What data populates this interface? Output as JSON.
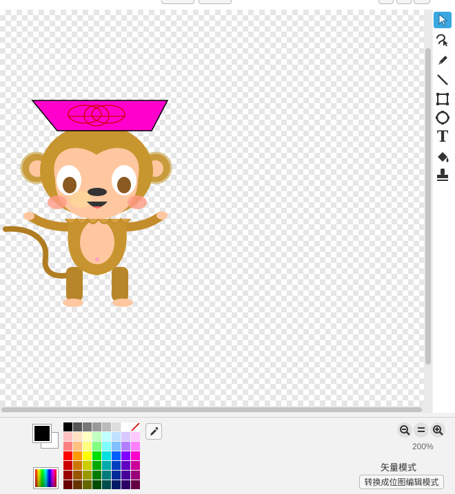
{
  "top_bar": {
    "button_1_label": "",
    "button_2_label": ""
  },
  "tools": [
    {
      "name": "select-tool",
      "icon": "arrow-cursor-icon",
      "active": true
    },
    {
      "name": "reshape-tool",
      "icon": "reshape-icon"
    },
    {
      "name": "pencil-tool",
      "icon": "pencil-icon"
    },
    {
      "name": "line-tool",
      "icon": "line-icon"
    },
    {
      "name": "rectangle-tool",
      "icon": "rectangle-icon"
    },
    {
      "name": "ellipse-tool",
      "icon": "ellipse-icon"
    },
    {
      "name": "text-tool",
      "icon": "text-T-icon",
      "glyph": "T"
    },
    {
      "name": "fill-tool",
      "icon": "paint-bucket-icon"
    },
    {
      "name": "stamp-tool",
      "icon": "stamp-icon"
    }
  ],
  "colors": {
    "primary": "#000000",
    "secondary": "#ffffff",
    "accent_active_tool": "#3aa7e0",
    "palette": [
      "#000000",
      "#555555",
      "#777777",
      "#999999",
      "#bbbbbb",
      "#dddddd",
      "#ffffff",
      "none",
      "#ffc0c0",
      "#ffe0c0",
      "#ffffc0",
      "#c0ffc0",
      "#c0ffff",
      "#c0e0ff",
      "#d8c8ff",
      "#ffc8ff",
      "#ff8080",
      "#ffc080",
      "#ffff80",
      "#80ff80",
      "#80ffff",
      "#80c0ff",
      "#b080ff",
      "#ff80ff",
      "#ff0000",
      "#ff9900",
      "#ffff00",
      "#00e000",
      "#00e0e0",
      "#0060ff",
      "#8000ff",
      "#ff00cc",
      "#cc0000",
      "#cc7700",
      "#cccc00",
      "#00a800",
      "#00aaaa",
      "#0040c0",
      "#6000c0",
      "#cc0099",
      "#990000",
      "#995500",
      "#999900",
      "#007a00",
      "#007a7a",
      "#002a99",
      "#450099",
      "#990077",
      "#660000",
      "#663300",
      "#666600",
      "#004d00",
      "#004d4d",
      "#001a66",
      "#2d0066",
      "#660044"
    ]
  },
  "zoom": {
    "level": "200%"
  },
  "mode": {
    "label": "矢量模式",
    "convert_button": "转换成位图编辑模式"
  }
}
